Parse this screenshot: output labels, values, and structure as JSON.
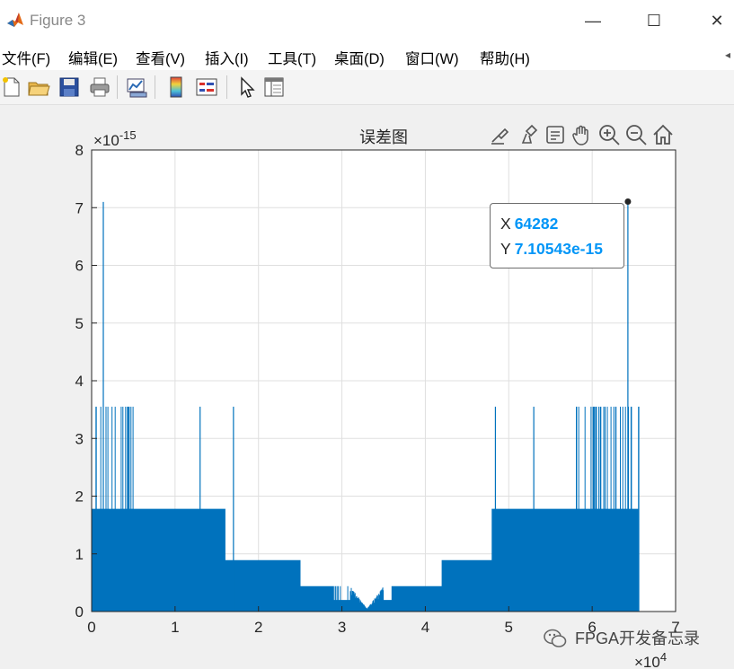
{
  "window": {
    "title": "Figure 3",
    "minimize_glyph": "—",
    "maximize_glyph": "☐",
    "close_glyph": "✕"
  },
  "menu": {
    "items": [
      "文件(F)",
      "编辑(E)",
      "查看(V)",
      "插入(I)",
      "工具(T)",
      "桌面(D)",
      "窗口(W)",
      "帮助(H)"
    ]
  },
  "toolbar": {
    "icons": [
      "new-figure-icon",
      "open-file-icon",
      "save-icon",
      "print-icon",
      "link-plot-icon",
      "insert-colorbar-icon",
      "insert-legend-icon",
      "pointer-icon",
      "property-inspector-icon"
    ]
  },
  "axes_toolbar": {
    "icons": [
      "edit-text-icon",
      "brush-icon",
      "data-tips-icon",
      "pan-hand-icon",
      "zoom-in-icon",
      "zoom-out-icon",
      "home-icon"
    ]
  },
  "datatip": {
    "x_label": "X",
    "x_value": "64282",
    "y_label": "Y",
    "y_value": "7.10543e-15"
  },
  "watermark": {
    "text": "FPGA开发备忘录"
  },
  "colors": {
    "line": "#0072bd",
    "datatip_value": "#0095f7",
    "grid": "#dfdfdf"
  },
  "chart_data": {
    "type": "line",
    "title": "误差图",
    "xlabel": "",
    "ylabel": "",
    "x_exponent_label": "×10",
    "x_exponent": "4",
    "y_exponent_label": "×10",
    "y_exponent": "-15",
    "xlim": [
      0,
      7
    ],
    "ylim": [
      0,
      8
    ],
    "x_ticks": [
      "0",
      "1",
      "2",
      "3",
      "4",
      "5",
      "6",
      "7"
    ],
    "y_ticks": [
      "0",
      "1",
      "2",
      "3",
      "4",
      "5",
      "6",
      "7",
      "8"
    ],
    "grid": true,
    "x_data_max": 6.56,
    "series": [
      {
        "envelope": [
          {
            "x_range": [
              0,
              0.52
            ],
            "typical": 1.78,
            "max": 3.55
          },
          {
            "x_range": [
              0.52,
              1.6
            ],
            "typical": 1.78,
            "max": 1.78
          },
          {
            "x_range": [
              1.6,
              2.5
            ],
            "typical": 0.89,
            "max": 0.89
          },
          {
            "x_range": [
              2.5,
              2.9
            ],
            "typical": 0.44,
            "max": 0.44
          },
          {
            "x_range": [
              2.9,
              3.6
            ],
            "typical": 0.2,
            "max": 0.44
          },
          {
            "x_range": [
              3.6,
              4.2
            ],
            "typical": 0.44,
            "max": 0.44
          },
          {
            "x_range": [
              4.2,
              4.8
            ],
            "typical": 0.89,
            "max": 0.89
          },
          {
            "x_range": [
              4.8,
              5.8
            ],
            "typical": 1.78,
            "max": 1.78
          },
          {
            "x_range": [
              5.8,
              6.56
            ],
            "typical": 1.78,
            "max": 3.55
          }
        ],
        "spikes": [
          {
            "x": 0.14,
            "y": 7.1
          },
          {
            "x": 1.3,
            "y": 3.55
          },
          {
            "x": 1.7,
            "y": 3.55
          },
          {
            "x": 4.84,
            "y": 3.55
          },
          {
            "x": 5.3,
            "y": 3.55
          },
          {
            "x": 6.4282,
            "y": 7.10543
          }
        ],
        "highlighted_point": {
          "x": 6.4282,
          "y": 7.10543
        }
      }
    ]
  }
}
